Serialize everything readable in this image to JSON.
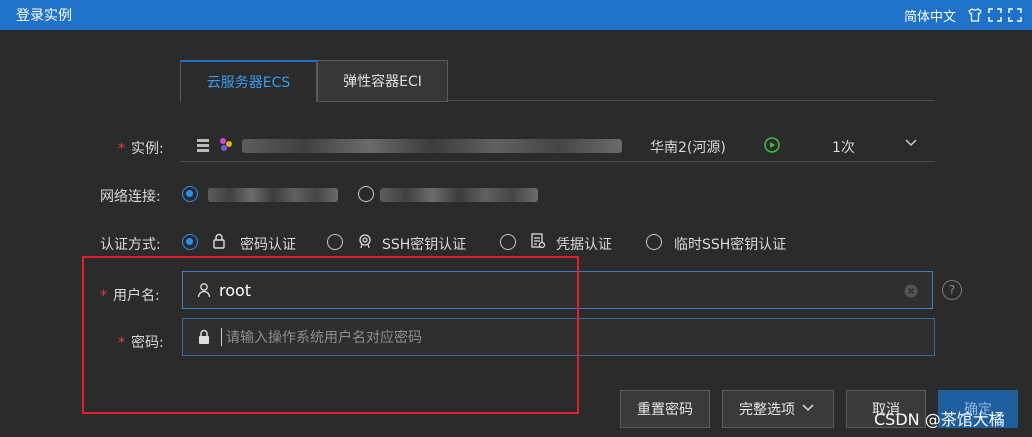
{
  "window": {
    "title": "登录实例",
    "language": "简体中文"
  },
  "tabs": [
    {
      "label": "云服务器ECS",
      "active": true
    },
    {
      "label": "弹性容器ECI",
      "active": false
    }
  ],
  "form": {
    "instance": {
      "label": "实例:",
      "region": "华南2(河源)",
      "count": "1次"
    },
    "network": {
      "label": "网络连接:"
    },
    "auth": {
      "label": "认证方式:",
      "options": [
        {
          "label": "密码认证",
          "selected": true
        },
        {
          "label": "SSH密钥认证",
          "selected": false
        },
        {
          "label": "凭据认证",
          "selected": false
        },
        {
          "label": "临时SSH密钥认证",
          "selected": false
        }
      ]
    },
    "username": {
      "label": "用户名:",
      "value": "root"
    },
    "password": {
      "label": "密码:",
      "placeholder": "请输入操作系统用户名对应密码"
    }
  },
  "buttons": {
    "reset_password": "重置密码",
    "full_options": "完整选项",
    "cancel": "取消",
    "confirm": "确定"
  },
  "watermark": "CSDN @茶馆大橘",
  "colors": {
    "accent": "#1f72c9",
    "required": "#e04040",
    "highlight_box": "#e0202a"
  }
}
